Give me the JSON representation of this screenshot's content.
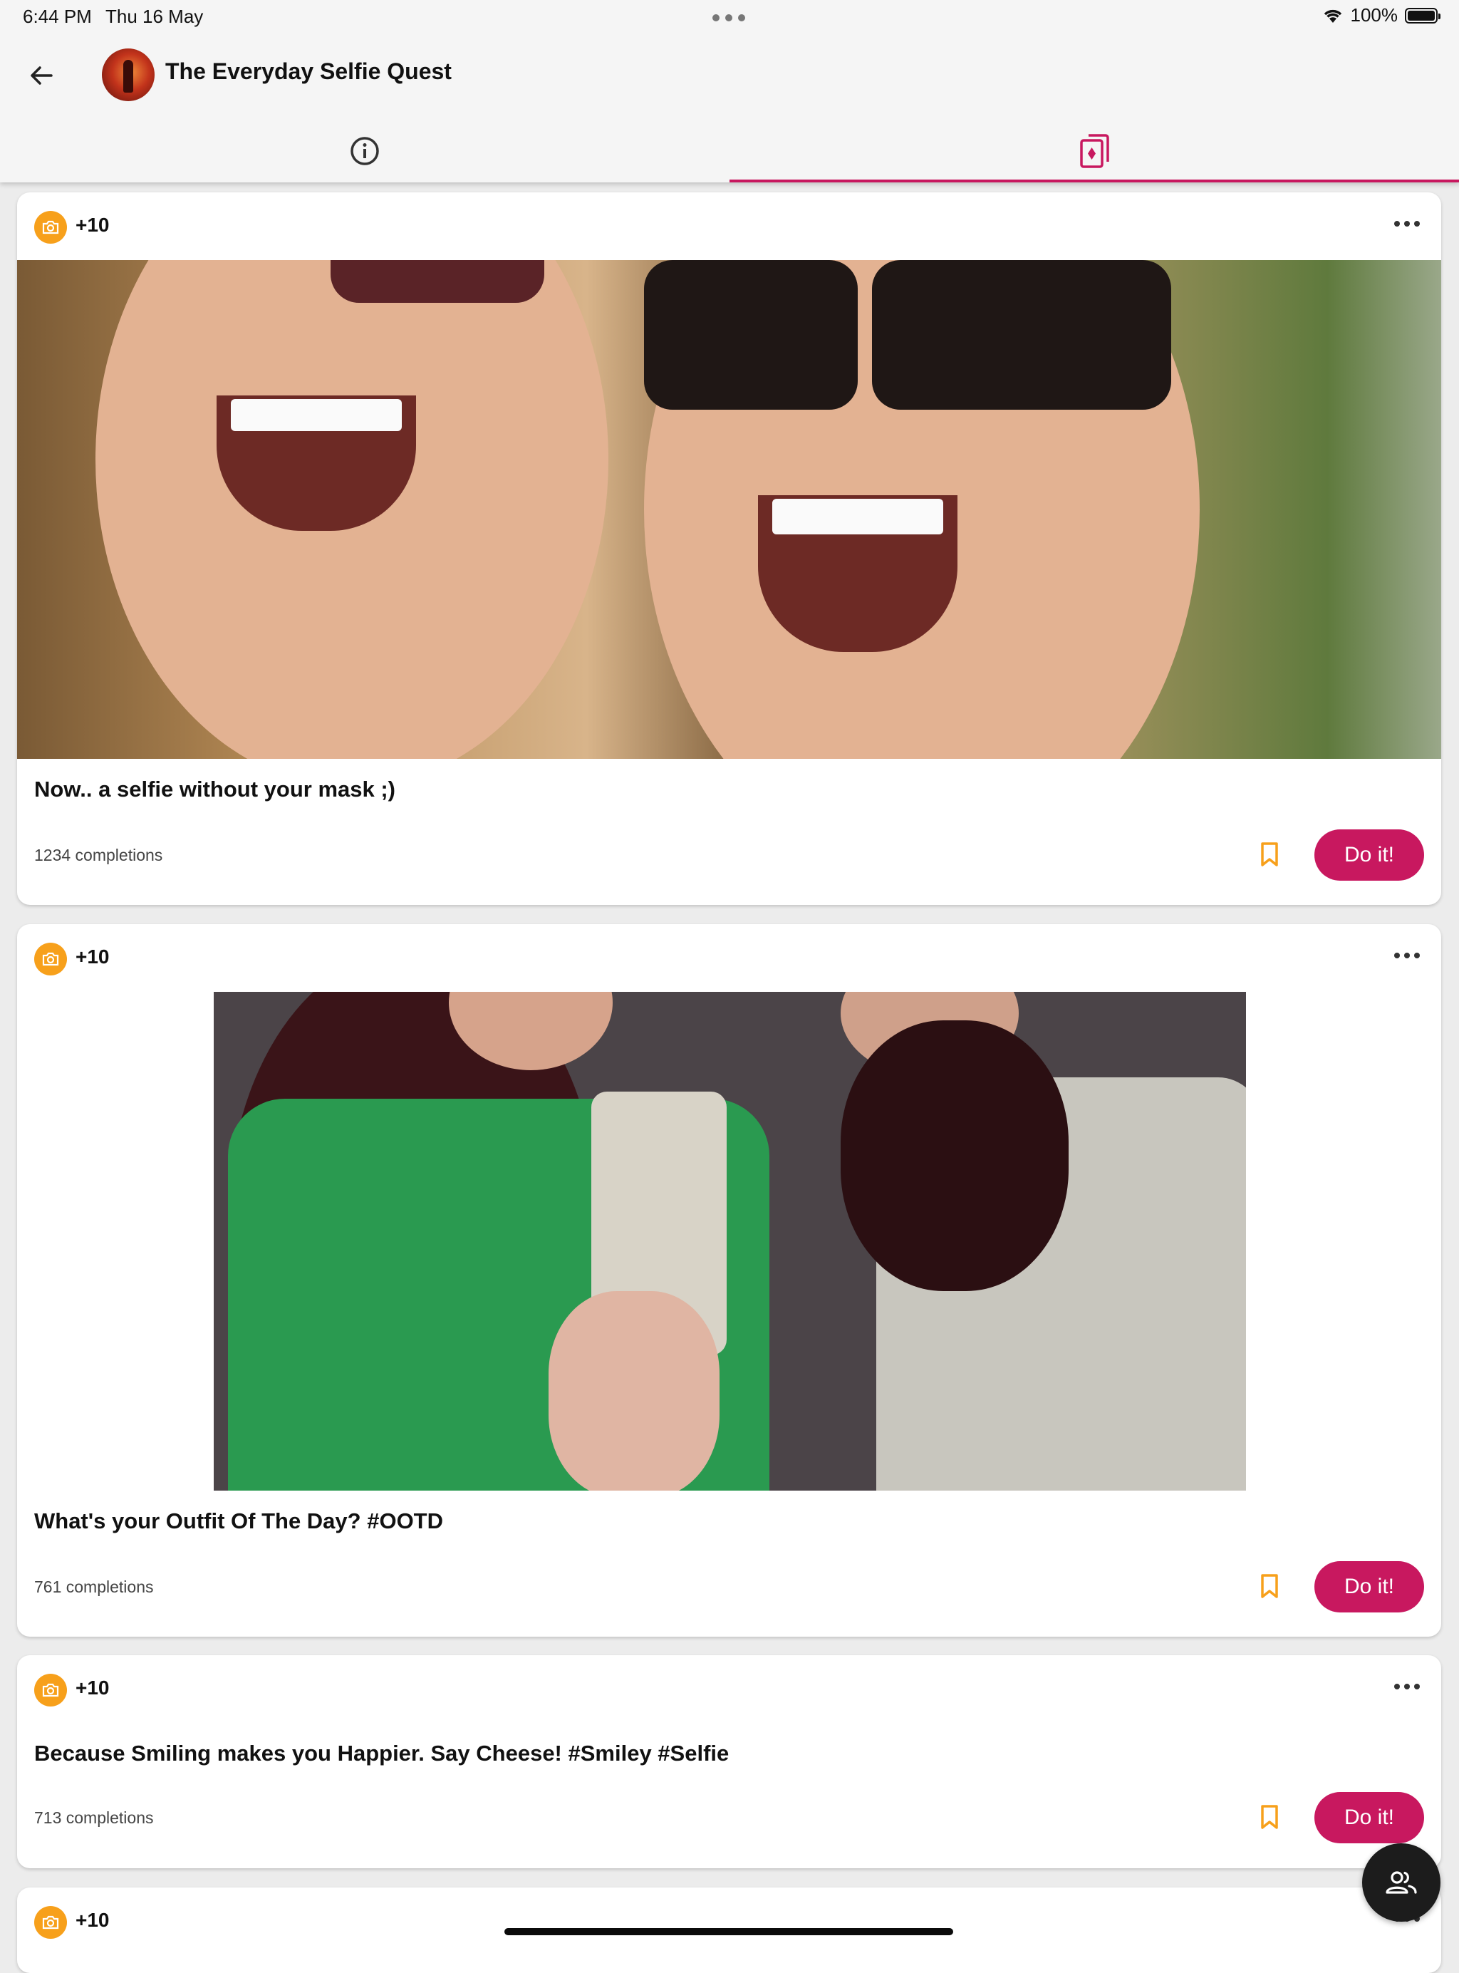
{
  "status_bar": {
    "time": "6:44 PM",
    "date": "Thu 16 May",
    "battery": "100%"
  },
  "header": {
    "title": "The Everyday Selfie Quest"
  },
  "tabs": [
    {
      "name": "info"
    },
    {
      "name": "challenges",
      "active": true
    }
  ],
  "colors": {
    "accent": "#c8185f",
    "badge": "#f7a01b"
  },
  "cards": [
    {
      "points": "+10",
      "title": "Now.. a selfie without your mask ;)",
      "completions": "1234 completions",
      "button": "Do it!"
    },
    {
      "points": "+10",
      "title": "What's your Outfit Of The Day? #OOTD",
      "completions": "761 completions",
      "button": "Do it!"
    },
    {
      "points": "+10",
      "title": "Because Smiling makes you Happier. Say Cheese! #Smiley #Selfie",
      "completions": "713 completions",
      "button": "Do it!"
    },
    {
      "points": "+10"
    }
  ]
}
